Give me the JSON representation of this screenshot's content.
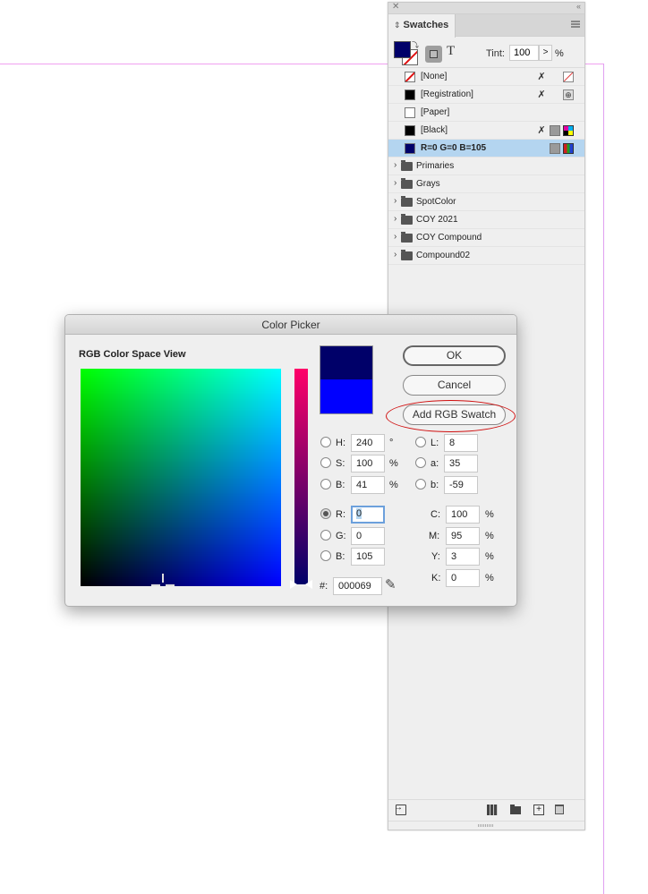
{
  "swatches_panel": {
    "close_icon": "close-icon",
    "collapse_icon": "double-chevron-icon",
    "tab_label": "Swatches",
    "tab_updown": "↕",
    "fill_color": "#000069",
    "text_button": "T",
    "tint_label": "Tint:",
    "tint_value": "100",
    "tint_arrow": ">",
    "tint_unit": "%",
    "swatches": [
      {
        "name": "[None]",
        "chip": "none",
        "icons": [
          "no-edit",
          "none-type"
        ]
      },
      {
        "name": "[Registration]",
        "chip": "#000000",
        "icons": [
          "no-edit",
          "registration-type"
        ]
      },
      {
        "name": "[Paper]",
        "chip": "#ffffff",
        "icons": []
      },
      {
        "name": "[Black]",
        "chip": "#000000",
        "icons": [
          "no-edit",
          "process",
          "cmyk"
        ]
      },
      {
        "name": "R=0 G=0 B=105",
        "chip": "#000069",
        "icons": [
          "process",
          "rgb"
        ],
        "selected": true
      }
    ],
    "groups": [
      {
        "name": "Primaries"
      },
      {
        "name": "Grays"
      },
      {
        "name": "SpotColor"
      },
      {
        "name": "COY 2021"
      },
      {
        "name": "COY Compound"
      },
      {
        "name": "Compound02"
      }
    ]
  },
  "color_picker": {
    "title": "Color Picker",
    "color_space_label": "RGB Color Space View",
    "new_color": "#000069",
    "original_color": "#0000ff",
    "buttons": {
      "ok": "OK",
      "cancel": "Cancel",
      "add_swatch": "Add RGB Swatch"
    },
    "hsb": [
      {
        "label": "H:",
        "value": "240",
        "unit": "°"
      },
      {
        "label": "S:",
        "value": "100",
        "unit": "%"
      },
      {
        "label": "B:",
        "value": "41",
        "unit": "%"
      }
    ],
    "lab": [
      {
        "label": "L:",
        "value": "8"
      },
      {
        "label": "a:",
        "value": "35"
      },
      {
        "label": "b:",
        "value": "-59"
      }
    ],
    "rgb": [
      {
        "label": "R:",
        "value": "0",
        "selected": true
      },
      {
        "label": "G:",
        "value": "0"
      },
      {
        "label": "B:",
        "value": "105"
      }
    ],
    "cmyk": [
      {
        "label": "C:",
        "value": "100",
        "unit": "%"
      },
      {
        "label": "M:",
        "value": "95",
        "unit": "%"
      },
      {
        "label": "Y:",
        "value": "3",
        "unit": "%"
      },
      {
        "label": "K:",
        "value": "0",
        "unit": "%"
      }
    ],
    "hex_label": "#:",
    "hex_value": "000069",
    "field_marker": {
      "blue": 105,
      "green": 0
    },
    "slider_red": 0
  }
}
